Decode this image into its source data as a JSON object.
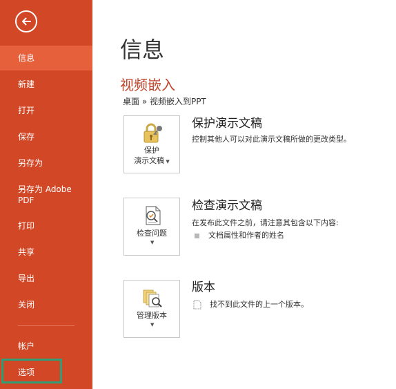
{
  "sidebar": {
    "items": [
      {
        "label": "信息"
      },
      {
        "label": "新建"
      },
      {
        "label": "打开"
      },
      {
        "label": "保存"
      },
      {
        "label": "另存为"
      },
      {
        "label": "另存为 Adobe PDF"
      },
      {
        "label": "打印"
      },
      {
        "label": "共享"
      },
      {
        "label": "导出"
      },
      {
        "label": "关闭"
      },
      {
        "label": "帐户"
      },
      {
        "label": "选项"
      }
    ],
    "active_item": "信息"
  },
  "main": {
    "page_title": "信息",
    "document_title": "视频嵌入",
    "breadcrumb": "桌面 » 视频嵌入到PPT",
    "sections": [
      {
        "button_line1": "保护",
        "button_line2": "演示文稿",
        "title": "保护演示文稿",
        "description": "控制其他人可以对此演示文稿所做的更改类型。",
        "icon": "lock-key-icon"
      },
      {
        "button_line1": "检查问题",
        "title": "检查演示文稿",
        "description": "在发布此文件之前，请注意其包含以下内容:",
        "bullet": "文档属性和作者的姓名",
        "icon": "inspect-document-icon"
      },
      {
        "button_line1": "管理版本",
        "title": "版本",
        "description": "找不到此文件的上一个版本。",
        "icon": "manage-versions-icon"
      }
    ]
  },
  "colors": {
    "sidebar_bg": "#d24726",
    "sidebar_active": "#e6603c",
    "accent_title": "#c1442b",
    "highlight_box": "#2e9e78"
  }
}
